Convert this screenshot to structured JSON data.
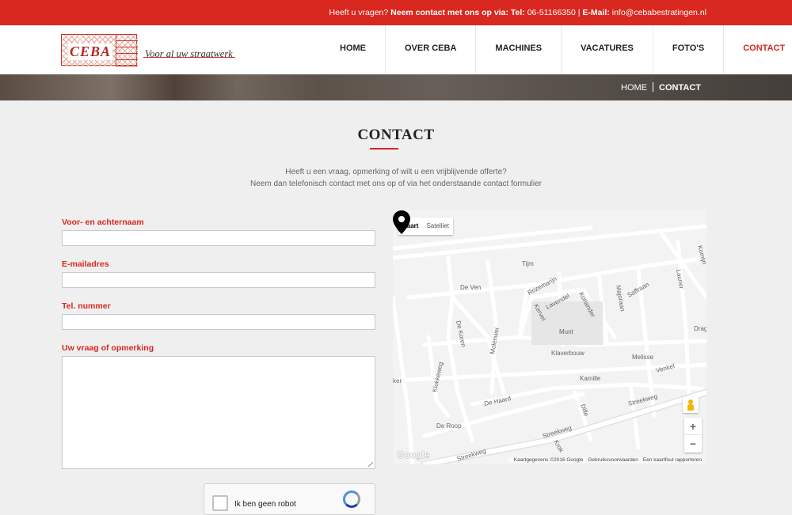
{
  "topbar": {
    "question": "Heeft u vragen?",
    "contact_strong": "Neem contact met ons op via",
    "tel_label": "Tel",
    "tel_value": "06-51166350",
    "email_label": "E-Mail",
    "email_value": "info@cebabestratingen.nl"
  },
  "logo": {
    "name": "CEBA",
    "tagline": "Voor al uw straatwerk"
  },
  "nav": [
    {
      "label": "HOME",
      "active": false
    },
    {
      "label": "OVER CEBA",
      "active": false
    },
    {
      "label": "MACHINES",
      "active": false
    },
    {
      "label": "VACATURES",
      "active": false
    },
    {
      "label": "FOTO'S",
      "active": false
    },
    {
      "label": "CONTACT",
      "active": true
    }
  ],
  "breadcrumb": {
    "home": "HOME",
    "current": "CONTACT"
  },
  "page": {
    "title": "CONTACT",
    "intro_line1": "Heeft u een vraag, opmerking of wilt u een vrijblijvende offerte?",
    "intro_line2": "Neem dan telefonisch contact met ons op of via het onderstaande contact formulier"
  },
  "form": {
    "name_label": "Voor- en achternaam",
    "email_label": "E-mailadres",
    "phone_label": "Tel. nummer",
    "question_label": "Uw vraag of opmerking",
    "captcha_text": "Ik ben geen robot"
  },
  "map": {
    "type_map": "Kaart",
    "type_satellite": "Satelliet",
    "zoom_in": "+",
    "zoom_out": "−",
    "google": "Google",
    "attribution": "Kaartgegevens ©2016 Google",
    "terms": "Gebruiksvoorwaarden",
    "report": "Een kaartfout rapporteren",
    "streets": [
      "Tijm",
      "De Ven",
      "Rozemarijn",
      "Lavendel",
      "Koriander",
      "Kervel",
      "Munt",
      "Majoraan",
      "Saffraan",
      "Laurier",
      "Komijn",
      "De Koren",
      "Molenwei",
      "Klaverbouw",
      "Melisse",
      "Venkel",
      "Kamille",
      "Klokkeweg",
      "De Haard",
      "Dille",
      "Streekweg",
      "De Roop",
      "Krok",
      "Drag",
      "ker"
    ]
  }
}
